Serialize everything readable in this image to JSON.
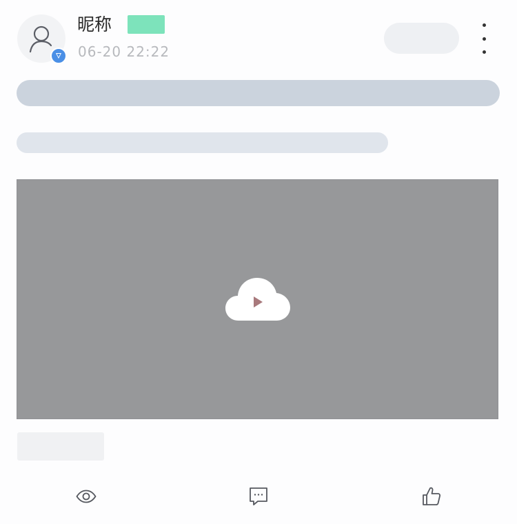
{
  "post": {
    "nickname": "昵称",
    "time": "06-20 22:22"
  },
  "icons": {
    "avatar": "person-icon",
    "verified": "verified-v-icon",
    "more": "more-vertical-icon",
    "play": "cloud-play-icon",
    "views": "eye-icon",
    "comments": "comment-icon",
    "likes": "thumbs-up-icon"
  },
  "colors": {
    "badge": "#7de3bb",
    "verified": "#4a8fe6",
    "video_bg": "#97989a",
    "placeholder_dark": "#cbd3dd",
    "placeholder_light": "#e0e5ec"
  }
}
